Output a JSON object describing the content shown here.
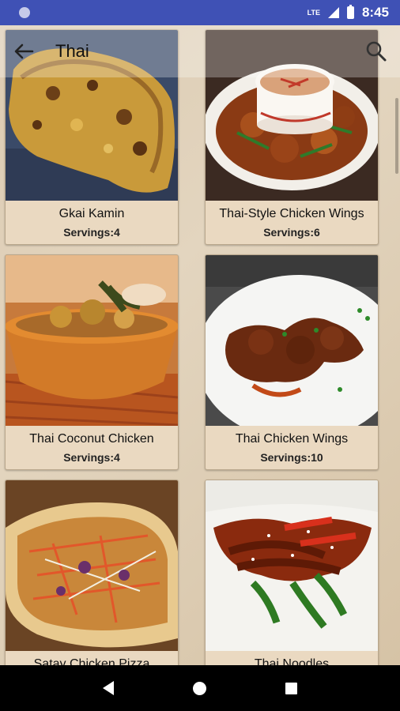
{
  "status_bar": {
    "network": "LTE",
    "time": "8:45"
  },
  "toolbar": {
    "title": "Thai"
  },
  "recipes": [
    {
      "title": "Gkai Kamin",
      "servings": "Servings:4"
    },
    {
      "title": "Thai-Style Chicken Wings",
      "servings": "Servings:6"
    },
    {
      "title": "Thai Coconut Chicken",
      "servings": "Servings:4"
    },
    {
      "title": "Thai Chicken Wings",
      "servings": "Servings:10"
    },
    {
      "title": "Satay Chicken Pizza",
      "servings": ""
    },
    {
      "title": "Thai Noodles",
      "servings": ""
    }
  ],
  "icons": {
    "back": "arrow-back-icon",
    "search": "search-icon",
    "nav_back": "triangle-back-icon",
    "nav_home": "circle-home-icon",
    "nav_recent": "square-recent-icon"
  }
}
